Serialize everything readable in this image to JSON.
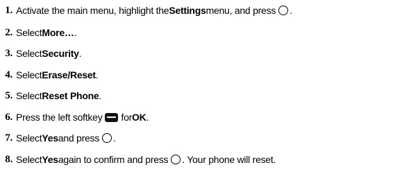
{
  "steps": [
    {
      "number": "1.",
      "text_a": "Activate the main menu, highlight the ",
      "bold_a": "Settings",
      "text_b": " menu, and press ",
      "icon": "select-key-icon",
      "text_c": "."
    },
    {
      "number": "2.",
      "text_a": "Select ",
      "bold_a": "More…",
      "text_b": "."
    },
    {
      "number": "3.",
      "text_a": "Select ",
      "bold_a": "Security",
      "text_b": "."
    },
    {
      "number": "4.",
      "text_a": "Select ",
      "bold_a": "Erase/Reset",
      "text_b": "."
    },
    {
      "number": "5.",
      "text_a": "Select ",
      "bold_a": "Reset Phone",
      "text_b": "."
    },
    {
      "number": "6.",
      "text_a": "Press the left softkey ",
      "icon": "left-softkey-icon",
      "text_b": " for ",
      "bold_a": "OK",
      "text_c": "."
    },
    {
      "number": "7.",
      "text_a": "Select ",
      "bold_a": "Yes",
      "text_b": " and press ",
      "icon": "select-key-icon",
      "text_c": "."
    },
    {
      "number": "8.",
      "text_a": "Select ",
      "bold_a": "Yes",
      "text_b": " again to confirm and press ",
      "icon": "select-key-icon",
      "text_c": ". Your phone will reset."
    }
  ]
}
